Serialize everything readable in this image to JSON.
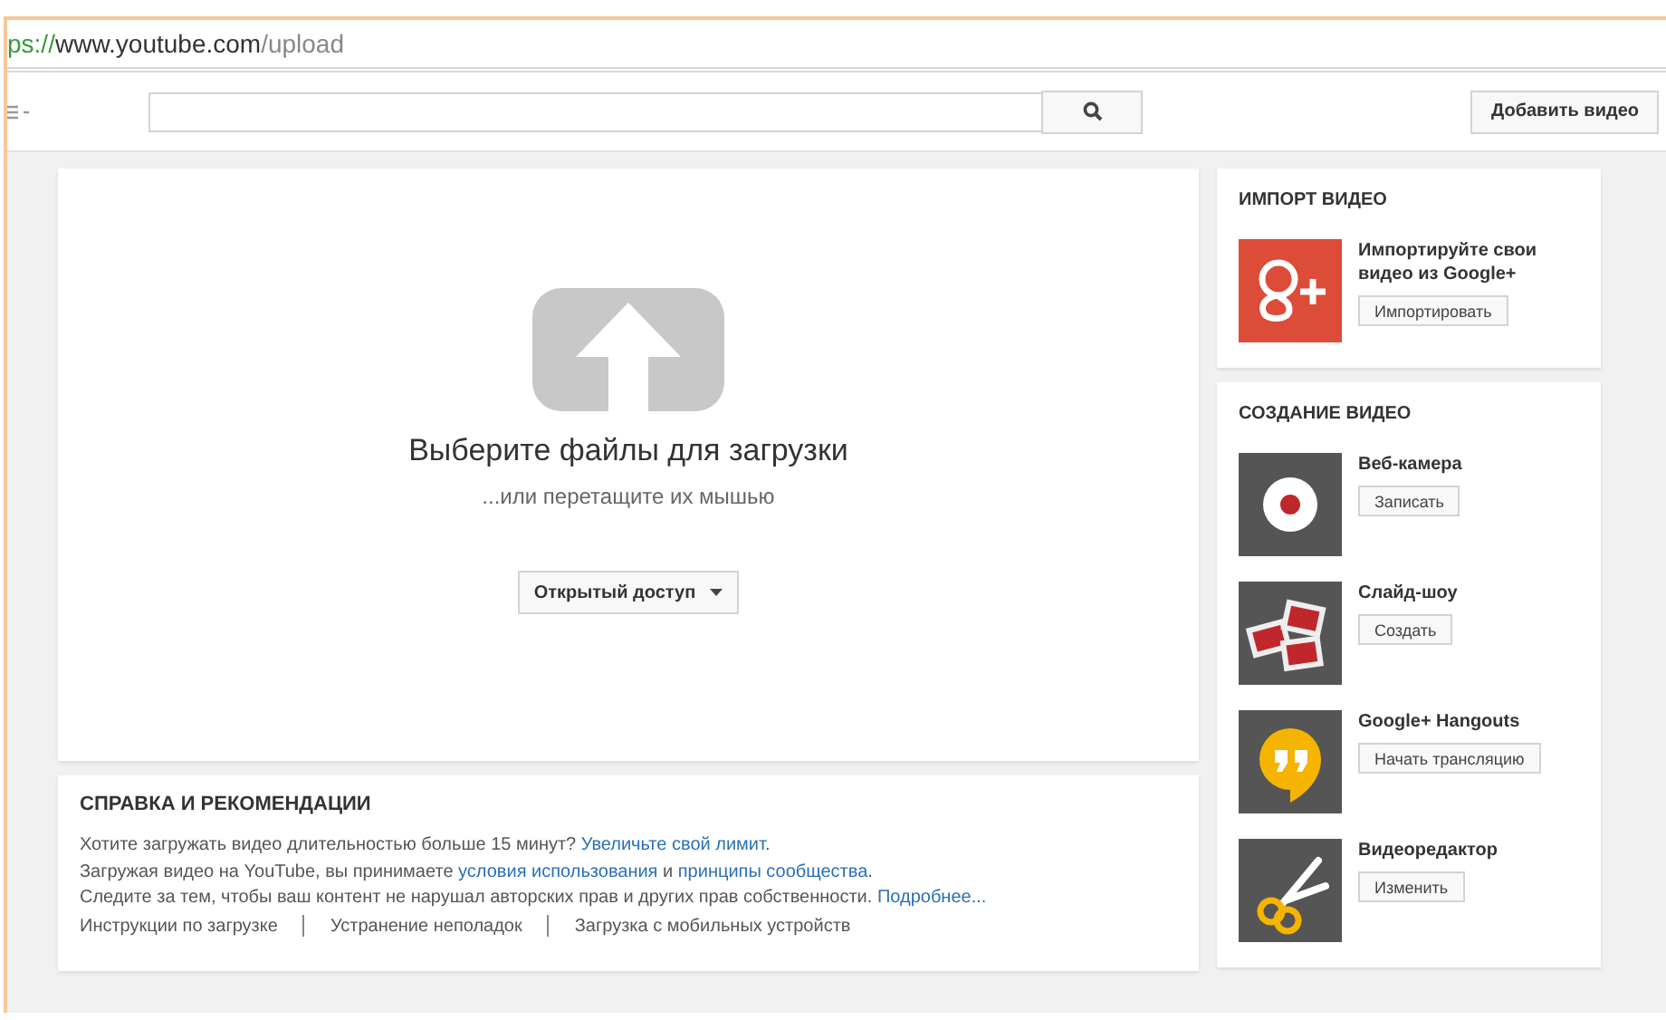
{
  "address_bar": {
    "url": [
      {
        "kind": "scheme",
        "text": "ps://"
      },
      {
        "kind": "host",
        "text": "www.youtube.com"
      },
      {
        "kind": "path",
        "text": "/upload"
      }
    ]
  },
  "header": {
    "add_video_button": "Добавить видео"
  },
  "upload": {
    "title": "Выберите файлы для загрузки",
    "subtitle": "...или перетащите их мышью",
    "privacy": "Открытый доступ"
  },
  "help": {
    "title": "СПРАВКА И РЕКОМЕНДАЦИИ",
    "lines": [
      [
        {
          "text": "Хотите загружать видео длительностью больше 15 минут? ",
          "kind": "text"
        },
        {
          "text": "Увеличьте свой лимит",
          "kind": "link"
        },
        {
          "text": ".",
          "kind": "text"
        }
      ],
      [
        {
          "text": "Загружая видео на YouTube, вы принимаете ",
          "kind": "text"
        },
        {
          "text": "условия использования",
          "kind": "link"
        },
        {
          "text": " и ",
          "kind": "text"
        },
        {
          "text": "принципы сообщества",
          "kind": "link"
        },
        {
          "text": ".",
          "kind": "text"
        }
      ],
      [
        {
          "text": "Следите за тем, чтобы ваш контент не нарушал авторских прав и других прав собственности. ",
          "kind": "text"
        },
        {
          "text": "Подробнее...",
          "kind": "link"
        }
      ]
    ],
    "links": [
      "Инструкции по загрузке",
      "Устранение неполадок",
      "Загрузка с мобильных устройств"
    ]
  },
  "sidebar": [
    {
      "title": "ИМПОРТ ВИДЕО",
      "items": [
        {
          "kind": "gplus",
          "label": "Импортируйте свои видео из Google+",
          "button": "Импортировать"
        }
      ]
    },
    {
      "title": "СОЗДАНИЕ ВИДЕО",
      "items": [
        {
          "kind": "webcam",
          "label": "Веб-камера",
          "button": "Записать"
        },
        {
          "kind": "slideshow",
          "label": "Слайд-шоу",
          "button": "Создать"
        },
        {
          "kind": "hangouts",
          "label": "Google+ Hangouts",
          "button": "Начать трансляцию"
        },
        {
          "kind": "editor",
          "label": "Видеоредактор",
          "button": "Изменить"
        }
      ]
    }
  ]
}
